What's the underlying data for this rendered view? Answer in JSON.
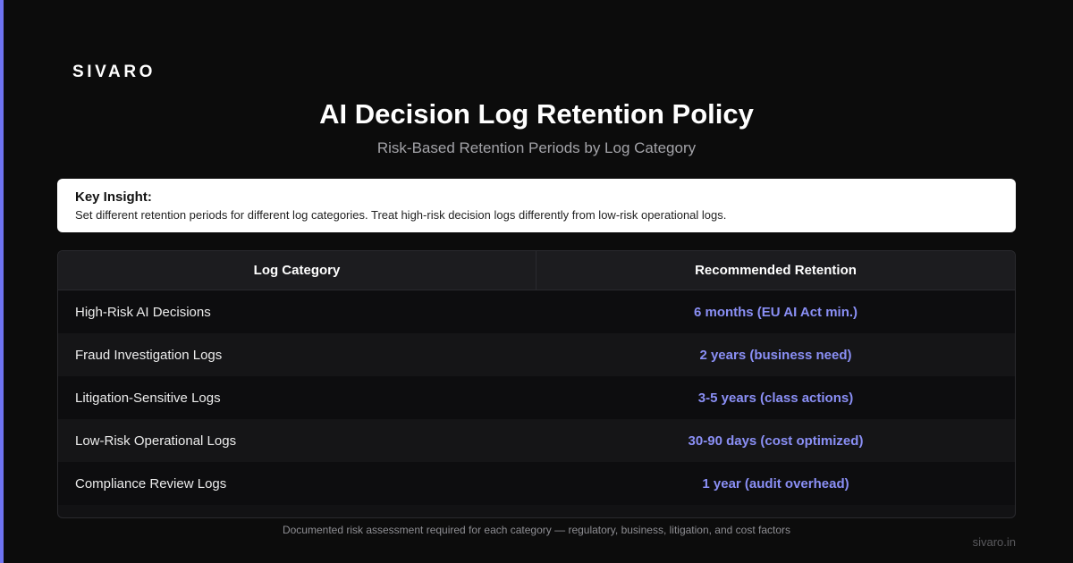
{
  "colors": {
    "accent": "#6f74f2",
    "retention_text": "#8a8ff5"
  },
  "brand": "SIVARO",
  "title": "AI Decision Log Retention Policy",
  "subtitle": "Risk-Based Retention Periods by Log Category",
  "insight": {
    "heading": "Key Insight:",
    "text": "Set different retention periods for different log categories. Treat high-risk decision logs differently from low-risk operational logs."
  },
  "table": {
    "headers": [
      "Log Category",
      "Recommended Retention"
    ],
    "rows": [
      {
        "category": "High-Risk AI Decisions",
        "retention": "6 months (EU AI Act min.)"
      },
      {
        "category": "Fraud Investigation Logs",
        "retention": "2 years (business need)"
      },
      {
        "category": "Litigation-Sensitive Logs",
        "retention": "3-5 years (class actions)"
      },
      {
        "category": "Low-Risk Operational Logs",
        "retention": "30-90 days (cost optimized)"
      },
      {
        "category": "Compliance Review Logs",
        "retention": "1 year (audit overhead)"
      }
    ]
  },
  "footnote": "Documented risk assessment required for each category — regulatory, business, litigation, and cost factors",
  "domain": "sivaro.in"
}
